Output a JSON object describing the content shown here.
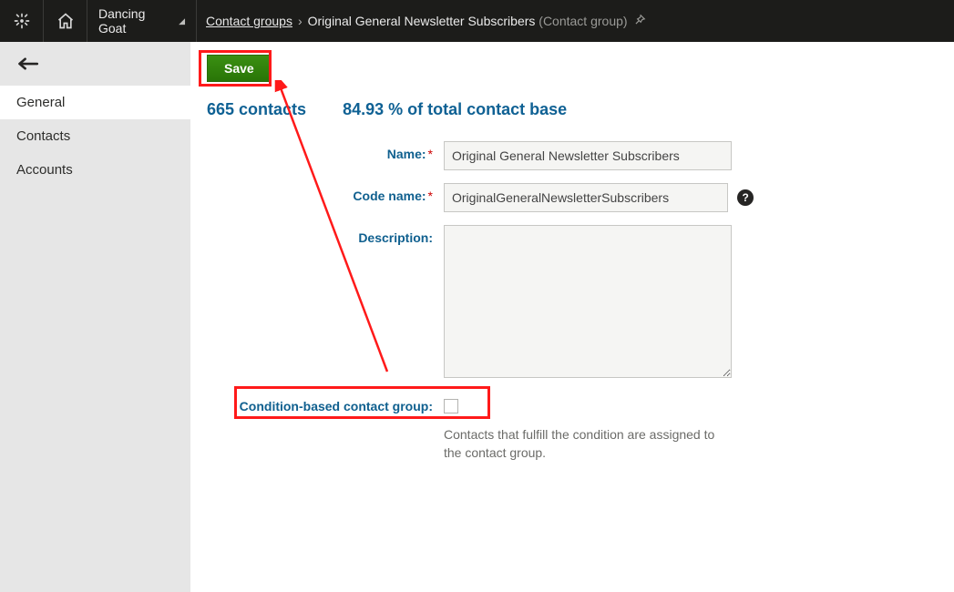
{
  "topbar": {
    "site_name": "Dancing Goat",
    "breadcrumb_parent": "Contact groups",
    "breadcrumb_item": "Original General Newsletter Subscribers",
    "breadcrumb_type": "(Contact group)"
  },
  "sidebar": {
    "items": [
      {
        "label": "General",
        "active": true
      },
      {
        "label": "Contacts",
        "active": false
      },
      {
        "label": "Accounts",
        "active": false
      }
    ]
  },
  "toolbar": {
    "save_label": "Save"
  },
  "stats": {
    "contacts": "665 contacts",
    "percent": "84.93 % of total contact base"
  },
  "form": {
    "name_label": "Name:",
    "name_value": "Original General Newsletter Subscribers",
    "codename_label": "Code name:",
    "codename_value": "OriginalGeneralNewsletterSubscribers",
    "description_label": "Description:",
    "description_value": "",
    "condition_label": "Condition-based contact group:",
    "condition_help": "Contacts that fulfill the condition are assigned to the contact group."
  }
}
